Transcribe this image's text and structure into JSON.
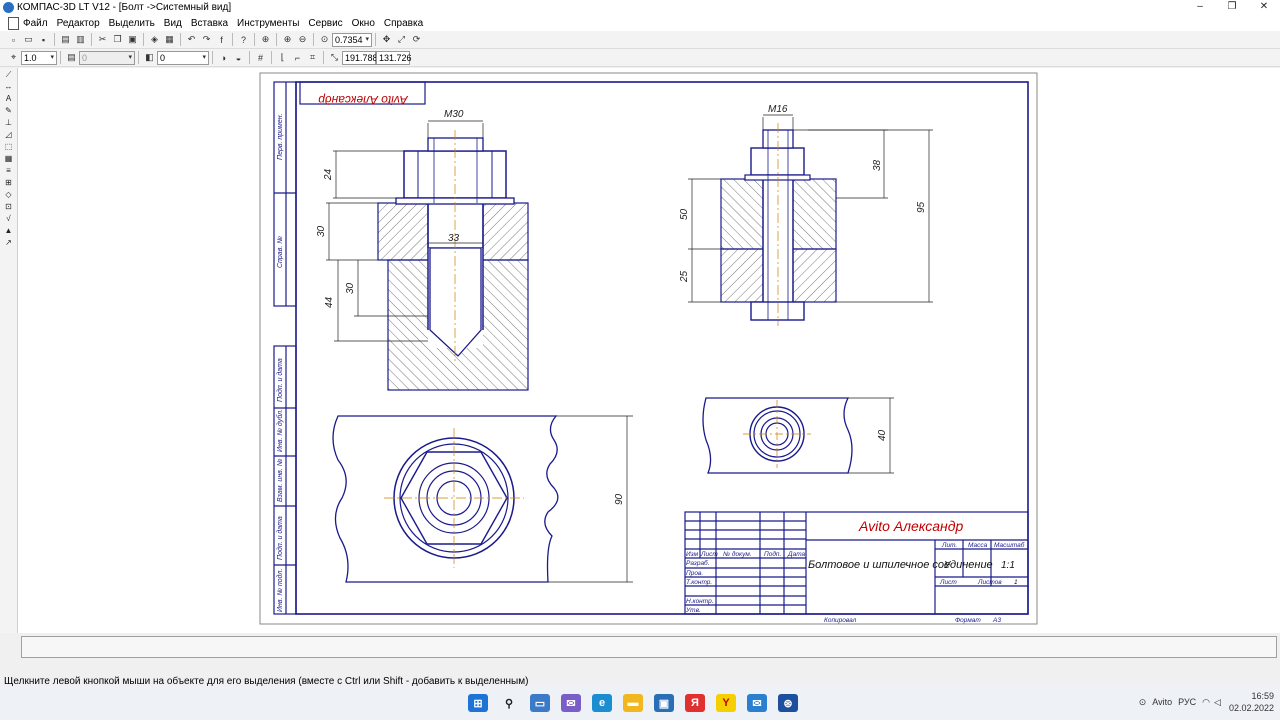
{
  "window": {
    "title": "КОМПАС-3D LT V12 - [Болт ->Системный вид]",
    "controls": [
      "–",
      "❐",
      "✕"
    ]
  },
  "menu": [
    "Файл",
    "Редактор",
    "Выделить",
    "Вид",
    "Вставка",
    "Инструменты",
    "Сервис",
    "Окно",
    "Справка"
  ],
  "toolbar1": {
    "zoom_value": "0.7354"
  },
  "toolbar2": {
    "step_value": "1.0",
    "layer_value": "0",
    "style_value": "0",
    "coord_x": "191.788",
    "coord_y": "131.726"
  },
  "drawing": {
    "stamp_text": "Avito Александр",
    "side_labels": [
      "Перв. примен.",
      "Справ. №",
      "Подп. и дата",
      "Инв. № дубл.",
      "Взам. инв. №",
      "Подп. и дата",
      "Инв. № подл."
    ],
    "dims": {
      "m30": "М30",
      "d24": "24",
      "d30a": "30",
      "d33": "33",
      "d44": "44",
      "d30b": "30",
      "m16": "М16",
      "d38": "38",
      "d95": "95",
      "d50": "50",
      "d25": "25",
      "d90": "90",
      "d40": "40"
    },
    "title_block": {
      "company": "Avito Александр",
      "doc_name": "Болтовое и шпилечное соединение",
      "lit": "Лит.",
      "mass": "Масса",
      "scale": "Масштаб",
      "lit_value": "У",
      "scale_value": "1:1",
      "sheet": "Лист",
      "sheets": "Листов",
      "sheets_value": "1",
      "row_labels": [
        "Изм",
        "Лист",
        "№ докум.",
        "Подп.",
        "Дата"
      ],
      "roles": [
        "Разраб.",
        "Пров.",
        "Т.контр.",
        "Н.контр.",
        "Утв."
      ],
      "copied": "Копировал",
      "format_label": "Формат",
      "format_value": "А3"
    }
  },
  "status": {
    "hint": "Щелкните левой кнопкой мыши на объекте для его выделения (вместе с Ctrl или Shift - добавить к выделенным)"
  },
  "taskbar": {
    "lang": "РУС",
    "time": "16:59",
    "date": "02.02.2022",
    "avito": "Avito"
  },
  "colors": {
    "frame": "#1a1a8c",
    "accent": "#c00000",
    "hatch": "#444444",
    "axis": "#d08000"
  }
}
